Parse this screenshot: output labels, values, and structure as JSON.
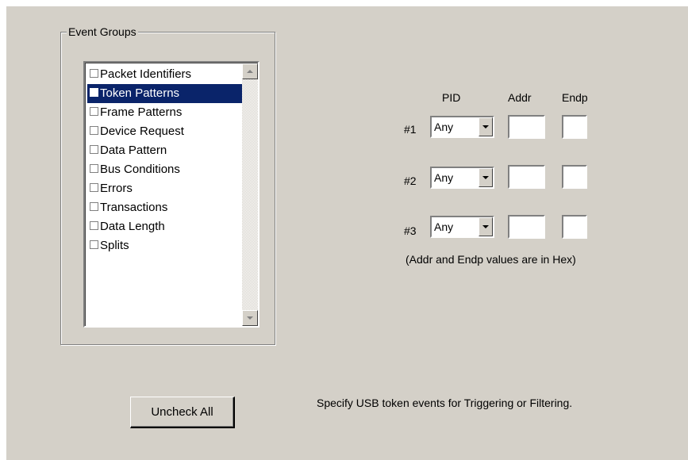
{
  "group_title": "Event Groups",
  "event_groups": [
    {
      "label": "Packet Identifiers",
      "checked": false,
      "selected": false
    },
    {
      "label": "Token Patterns",
      "checked": false,
      "selected": true
    },
    {
      "label": "Frame Patterns",
      "checked": false,
      "selected": false
    },
    {
      "label": "Device Request",
      "checked": false,
      "selected": false
    },
    {
      "label": "Data Pattern",
      "checked": false,
      "selected": false
    },
    {
      "label": "Bus Conditions",
      "checked": false,
      "selected": false
    },
    {
      "label": "Errors",
      "checked": false,
      "selected": false
    },
    {
      "label": "Transactions",
      "checked": false,
      "selected": false
    },
    {
      "label": "Data Length",
      "checked": false,
      "selected": false
    },
    {
      "label": "Splits",
      "checked": false,
      "selected": false
    }
  ],
  "columns": {
    "pid": "PID",
    "addr": "Addr",
    "endp": "Endp"
  },
  "rows": [
    {
      "label": "#1",
      "pid": "Any",
      "addr": "",
      "endp": ""
    },
    {
      "label": "#2",
      "pid": "Any",
      "addr": "",
      "endp": ""
    },
    {
      "label": "#3",
      "pid": "Any",
      "addr": "",
      "endp": ""
    }
  ],
  "hex_note": "(Addr and Endp values are in Hex)",
  "uncheck_all_label": "Uncheck All",
  "instruction": "Specify USB token events for Triggering or Filtering.",
  "colors": {
    "panel": "#d4d0c8",
    "selection": "#0a246a"
  }
}
